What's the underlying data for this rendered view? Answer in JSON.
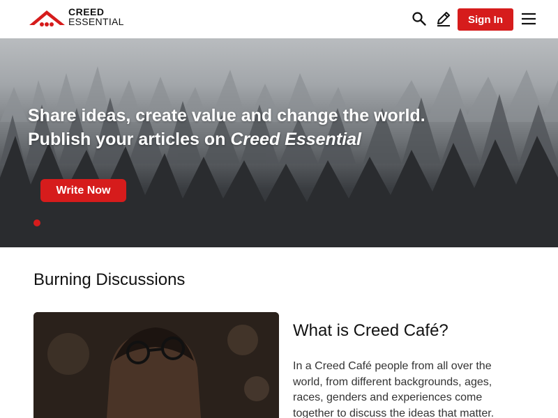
{
  "header": {
    "logo_line1": "CREED",
    "logo_line2": "ESSENTIAL",
    "signin_label": "Sign In",
    "icons": [
      "search-icon",
      "pen-icon",
      "menu-icon"
    ],
    "accent_color": "#d61c1c"
  },
  "hero": {
    "line1": "Share ideas, create value and change the world.",
    "line2_prefix": "Publish your articles on ",
    "line2_emphasis": "Creed Essential",
    "cta_label": "Write Now",
    "slides_count": 1,
    "active_slide": 1
  },
  "section": {
    "title": "Burning Discussions"
  },
  "cafe": {
    "title": "What is Creed Café?",
    "body": "In a Creed Café people from all over the world, from different backgrounds, ages, races, genders and experiences come together to discuss the ideas that matter."
  }
}
